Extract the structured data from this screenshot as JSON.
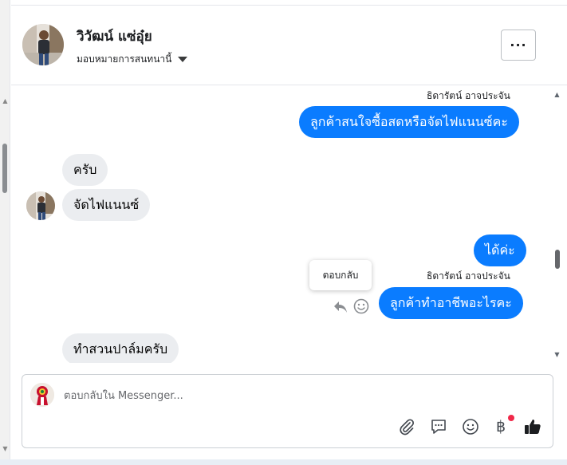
{
  "header": {
    "contact_name": "วิวัฒน์ แซ่อุ๋ย",
    "assign_label": "มอบหมายการสนทนานี้",
    "more_label": "···"
  },
  "messages": [
    {
      "sender": "ธิดารัตน์ อาจประจัน",
      "text": "ลูกค้าสนใจซื้อสดหรือจัดไฟแนนซ์คะ",
      "direction": "out"
    },
    {
      "text": "ครับ",
      "direction": "in"
    },
    {
      "text": "จัดไฟแนนซ์",
      "direction": "in"
    },
    {
      "text": "ได้ค่ะ",
      "direction": "out"
    },
    {
      "sender": "ธิดารัตน์ อาจประจัน",
      "text": "ลูกค้าทำอาชีพอะไรคะ",
      "direction": "out"
    },
    {
      "text": "ทำสวนปาล์มครับ",
      "direction": "in"
    }
  ],
  "tooltip": {
    "reply_label": "ตอบกลับ"
  },
  "composer": {
    "placeholder": "ตอบกลับใน Messenger...",
    "icons": [
      "paperclip-icon",
      "chat-bubble-icon",
      "emoji-icon",
      "baht-payment-icon",
      "thumbs-up-icon"
    ],
    "payment_symbol": "฿"
  },
  "colors": {
    "outgoing_bubble": "#0a7cff",
    "incoming_bubble": "#ebedf0",
    "like_icon": "#1c1e21",
    "notification_dot": "#f02849"
  }
}
